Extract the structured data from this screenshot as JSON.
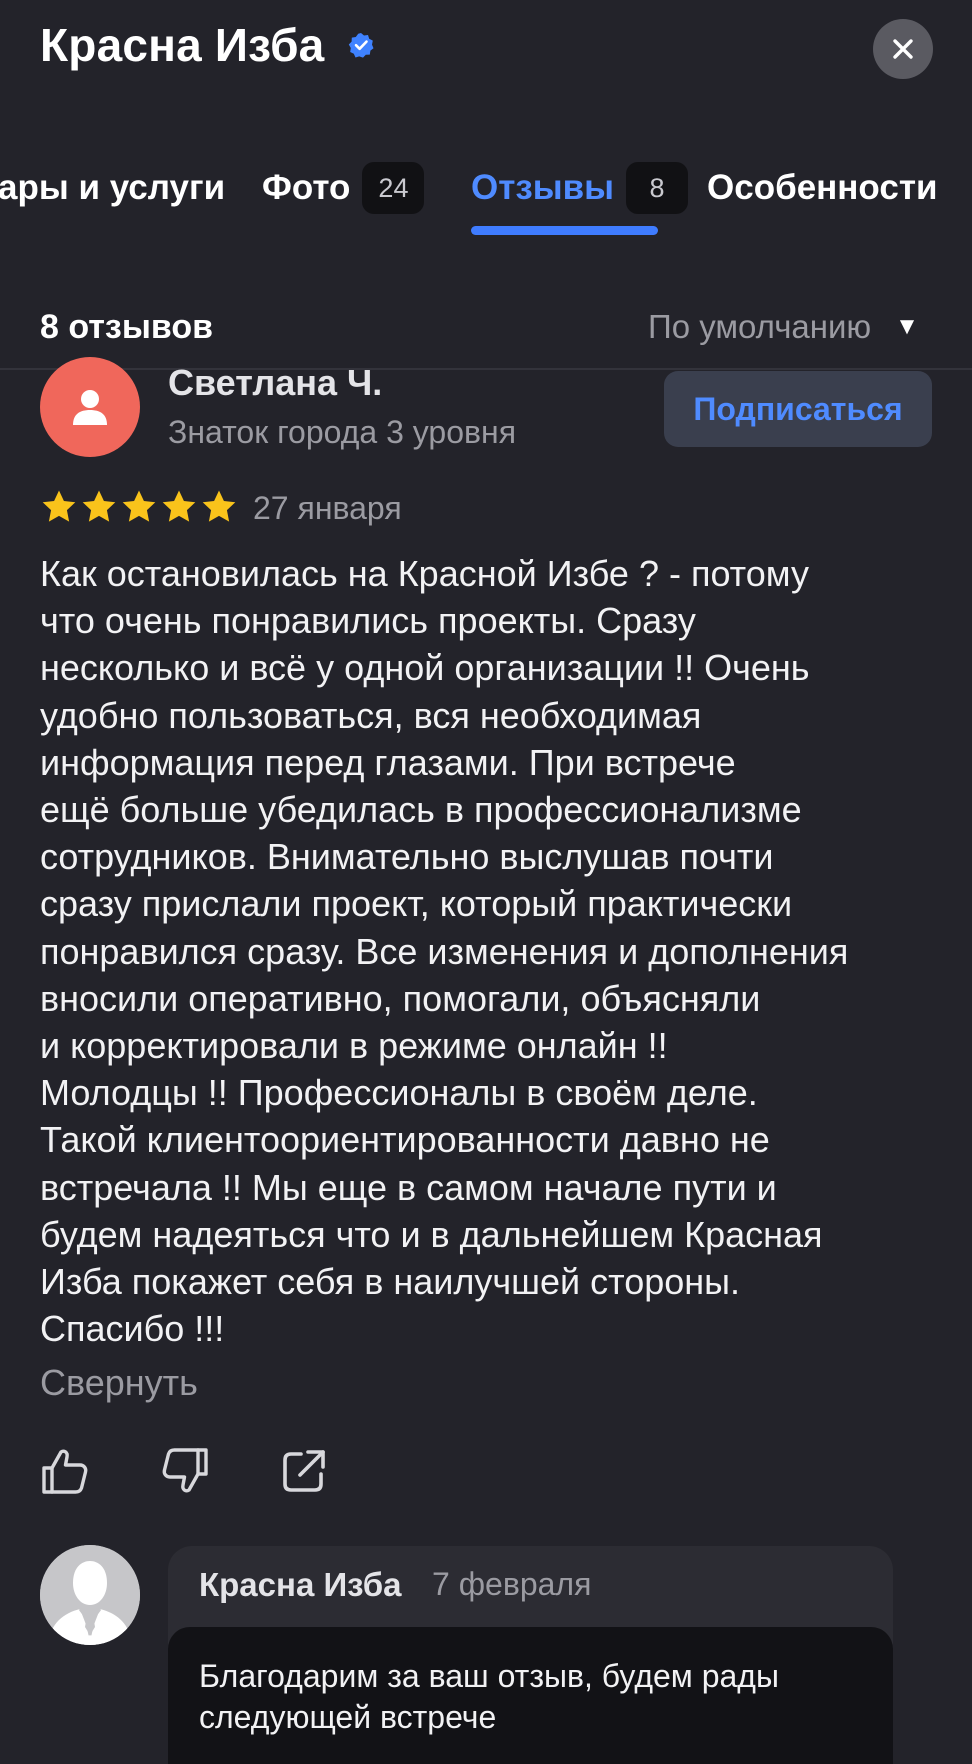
{
  "header": {
    "title": "Красна Изба",
    "verified_icon": "verified-check-icon",
    "close_icon": "close-icon"
  },
  "tabs": [
    {
      "label": "Товары и услуги",
      "visible_label": "ары и услуги",
      "count": ""
    },
    {
      "label": "Фото",
      "count": "24"
    },
    {
      "label": "Отзывы",
      "count": "8",
      "active": true
    },
    {
      "label": "Особенности",
      "count": ""
    }
  ],
  "reviews": {
    "count_label": "8 отзывов",
    "sort_label": "По умолчанию"
  },
  "review": {
    "author": "Светлана Ч.",
    "level": "Знаток города 3 уровня",
    "subscribe_label": "Подписаться",
    "rating": 5,
    "date": "27 января",
    "text_lines": [
      "Как остановилась на Красной Избе  ? - потому",
      "что очень понравились проекты. Сразу",
      "несколько и всё у одной организации !!  Очень",
      "удобно пользоваться, вся необходимая",
      "информация перед глазами. При встрече",
      "ещё больше убедилась в профессионализме",
      "сотрудников. Внимательно выслушав почти",
      "сразу прислали проект, который практически",
      "понравился сразу. Все изменения и дополнения",
      "вносили оперативно, помогали,  объясняли",
      "и корректировали в режиме онлайн !!",
      "Молодцы  !!  Профессионалы в своём деле.",
      "Такой клиентоориентированности давно не",
      "встречала !! Мы еще в самом начале пути и",
      "будем надеяться что и в дальнейшем Красная",
      "Изба покажет себя в наилучшей стороны.",
      "Спасибо !!!"
    ],
    "collapse_label": "Свернуть"
  },
  "reply": {
    "author": "Красна Изба",
    "date": "7 февраля",
    "text": "Благодарим за ваш отзыв, будем рады следующей встрече"
  },
  "colors": {
    "background": "#23232a",
    "accent": "#3f7cff",
    "avatar_red": "#f0675b",
    "star": "#f9c31b"
  }
}
